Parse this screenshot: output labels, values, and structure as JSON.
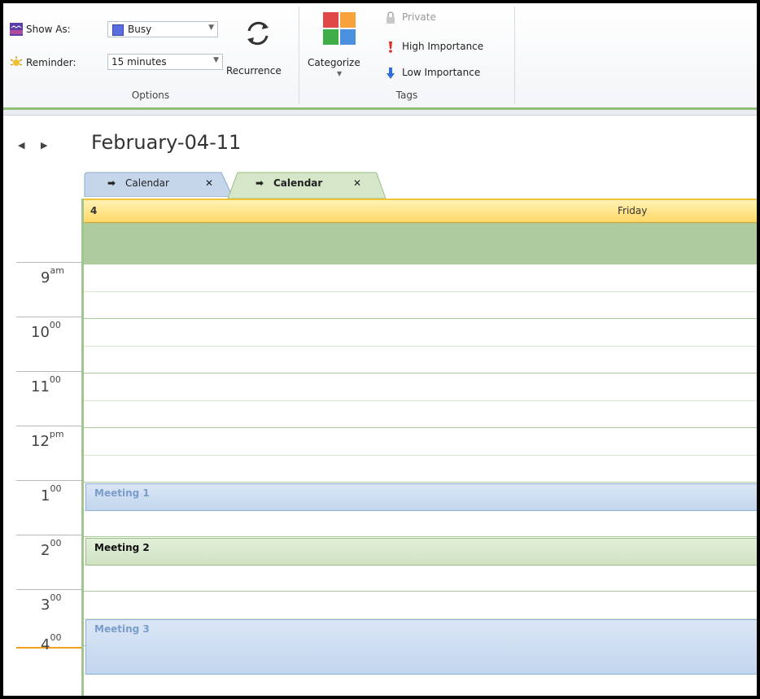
{
  "ribbon": {
    "show_as_label": "Show As:",
    "show_as_value": "Busy",
    "reminder_label": "Reminder:",
    "reminder_value": "15 minutes",
    "recurrence_label": "Recurrence",
    "options_group": "Options",
    "categorize_label": "Categorize",
    "private_label": "Private",
    "high_importance_label": "High Importance",
    "low_importance_label": "Low Importance",
    "tags_group": "Tags"
  },
  "calendar": {
    "date_title": "February-04-11",
    "tabs": [
      {
        "label": "Calendar",
        "close": "✕"
      },
      {
        "label": "Calendar",
        "close": "✕"
      }
    ],
    "day_number": "4",
    "day_name": "Friday",
    "times": [
      {
        "hour": "9",
        "suffix": "am"
      },
      {
        "hour": "10",
        "suffix": "00"
      },
      {
        "hour": "11",
        "suffix": "00"
      },
      {
        "hour": "12",
        "suffix": "pm"
      },
      {
        "hour": "1",
        "suffix": "00"
      },
      {
        "hour": "2",
        "suffix": "00"
      },
      {
        "hour": "3",
        "suffix": "00"
      },
      {
        "hour": "4",
        "suffix": "00"
      }
    ],
    "appointments": [
      {
        "title": "Meeting 1"
      },
      {
        "title": "Meeting 2"
      },
      {
        "title": "Meeting 3"
      }
    ]
  },
  "colors": {
    "accent_green": "#a2c48e",
    "day_header": "#ffd766",
    "appt_blue": "#c2d6ee",
    "appt_green": "#cfe3c2"
  }
}
